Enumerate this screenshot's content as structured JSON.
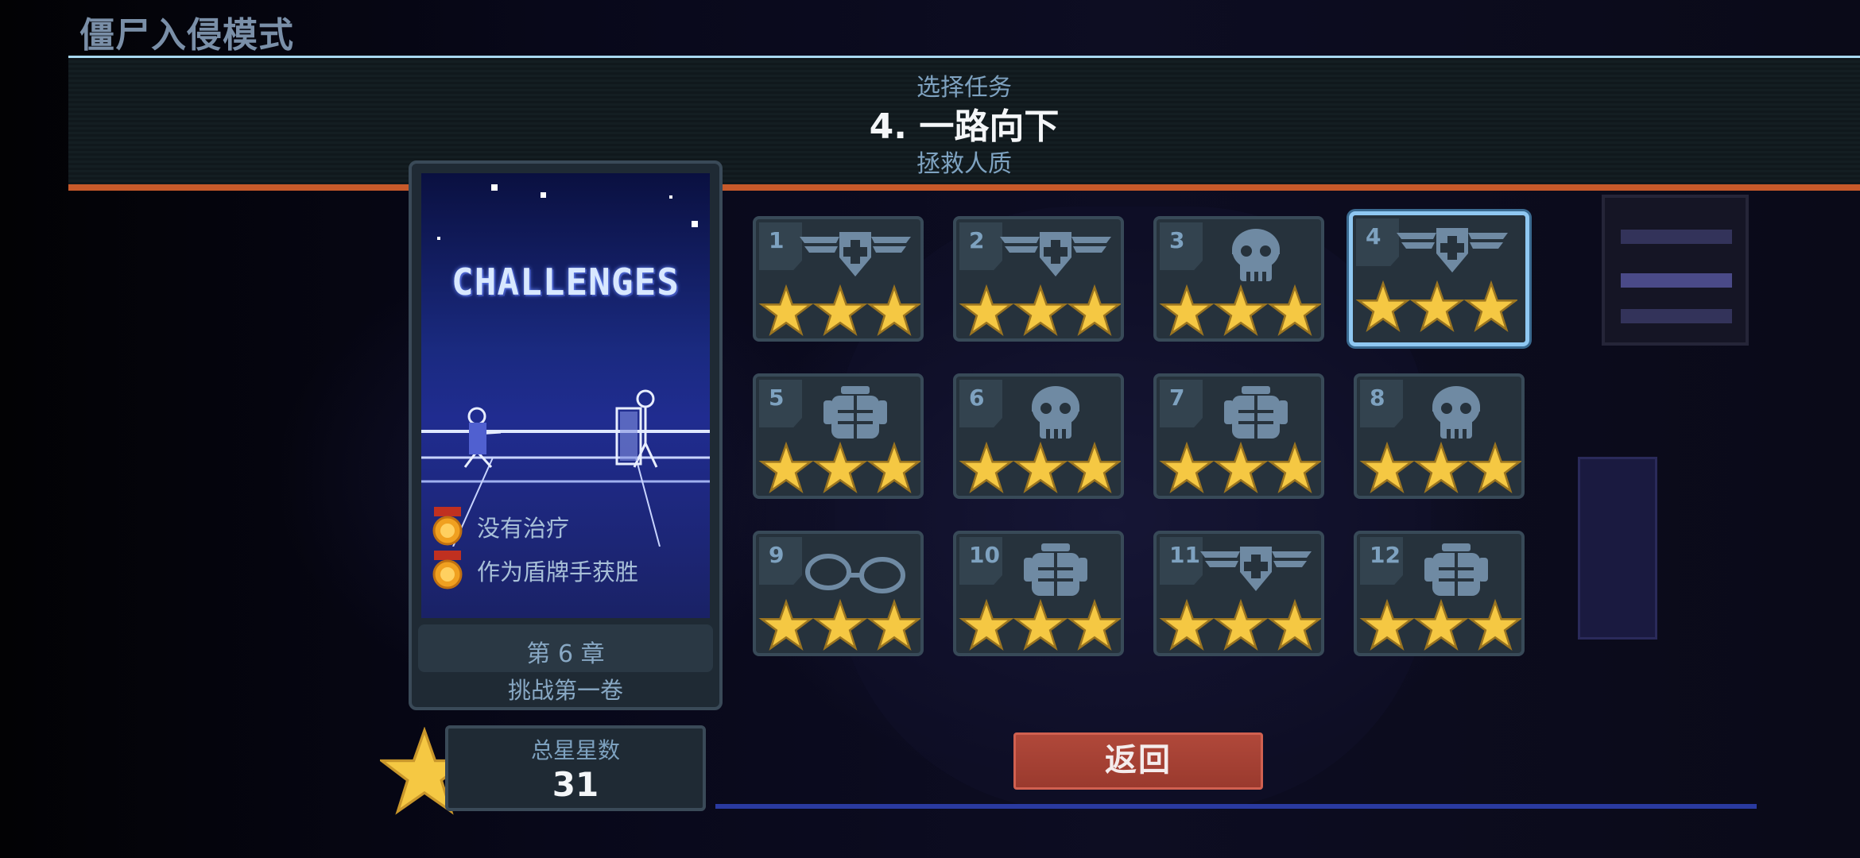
{
  "mode_title": "僵尸入侵模式",
  "header": {
    "subtitle": "选择任务",
    "mission_title": "4. 一路向下",
    "objective": "拯救人质"
  },
  "card": {
    "art_title": "CHALLENGES",
    "challenges": [
      {
        "label": "没有治疗",
        "icon": "medal-icon"
      },
      {
        "label": "作为盾牌手获胜",
        "icon": "medal-icon"
      }
    ],
    "chapter": "第 6 章",
    "volume": "挑战第一卷"
  },
  "total": {
    "label": "总星星数",
    "value": "31"
  },
  "missions": [
    {
      "num": "1",
      "icon": "medic-wings",
      "stars": 3
    },
    {
      "num": "2",
      "icon": "medic-wings",
      "stars": 3
    },
    {
      "num": "3",
      "icon": "skull",
      "stars": 3
    },
    {
      "num": "4",
      "icon": "medic-wings",
      "stars": 3,
      "selected": true
    },
    {
      "num": "5",
      "icon": "armor",
      "stars": 3
    },
    {
      "num": "6",
      "icon": "skull",
      "stars": 3
    },
    {
      "num": "7",
      "icon": "armor",
      "stars": 3
    },
    {
      "num": "8",
      "icon": "skull",
      "stars": 3
    },
    {
      "num": "9",
      "icon": "handcuffs",
      "stars": 3
    },
    {
      "num": "10",
      "icon": "armor",
      "stars": 3
    },
    {
      "num": "11",
      "icon": "medic-wings",
      "stars": 3
    },
    {
      "num": "12",
      "icon": "armor",
      "stars": 3
    }
  ],
  "back_button": "返回",
  "colors": {
    "star": "#f5c843",
    "accent": "#8fc8f2",
    "back": "#a8402f"
  }
}
